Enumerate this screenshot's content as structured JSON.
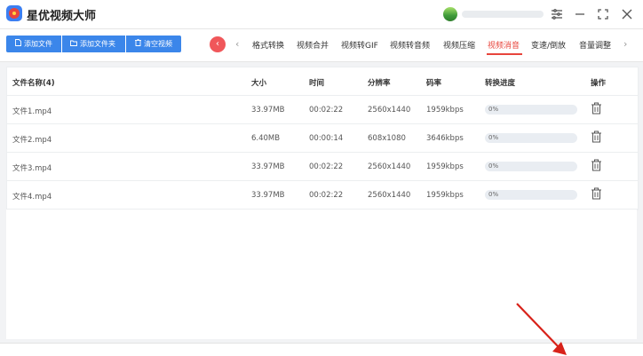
{
  "app": {
    "title": "星优视频大师"
  },
  "icons": {
    "logo": "app-logo-icon",
    "avatar": "user-avatar-icon",
    "menu": "hamburger-menu-icon",
    "minimize": "minimize-icon",
    "maximize": "maximize-icon",
    "close": "close-icon",
    "add_file": "file-icon",
    "add_folder": "folder-icon",
    "clear": "trash-icon",
    "nav_prev": "chevron-left-icon",
    "nav_next": "chevron-right-icon",
    "row_delete": "trash-icon"
  },
  "toolbar": {
    "add_file_label": "添加文件",
    "add_folder_label": "添加文件夹",
    "clear_label": "清空视频",
    "prev_arrow": "‹",
    "prev_arrow_grey": "‹",
    "next_arrow": "›"
  },
  "tabs": [
    {
      "label": "格式转换",
      "active": false
    },
    {
      "label": "视频合并",
      "active": false
    },
    {
      "label": "视频转GIF",
      "active": false
    },
    {
      "label": "视频转音频",
      "active": false
    },
    {
      "label": "视频压缩",
      "active": false
    },
    {
      "label": "视频消音",
      "active": true
    },
    {
      "label": "变速/倒放",
      "active": false
    },
    {
      "label": "音量调整",
      "active": false
    }
  ],
  "table": {
    "headers": {
      "name": "文件名称(4)",
      "size": "大小",
      "duration": "时间",
      "resolution": "分辨率",
      "bitrate": "码率",
      "progress": "转换进度",
      "action": "操作"
    },
    "rows": [
      {
        "name": "文件1.mp4",
        "size": "33.97MB",
        "duration": "00:02:22",
        "resolution": "2560x1440",
        "bitrate": "1959kbps",
        "progress": "0%",
        "progress_value": 0
      },
      {
        "name": "文件2.mp4",
        "size": "6.40MB",
        "duration": "00:00:14",
        "resolution": "608x1080",
        "bitrate": "3646kbps",
        "progress": "0%",
        "progress_value": 0
      },
      {
        "name": "文件3.mp4",
        "size": "33.97MB",
        "duration": "00:02:22",
        "resolution": "2560x1440",
        "bitrate": "1959kbps",
        "progress": "0%",
        "progress_value": 0
      },
      {
        "name": "文件4.mp4",
        "size": "33.97MB",
        "duration": "00:02:22",
        "resolution": "2560x1440",
        "bitrate": "1959kbps",
        "progress": "0%",
        "progress_value": 0
      }
    ]
  },
  "colors": {
    "accent_blue": "#3b86ea",
    "active_tab_red": "#e8453c",
    "nav_button_red": "#f0575a",
    "annotation_arrow_red": "#d8221a"
  }
}
